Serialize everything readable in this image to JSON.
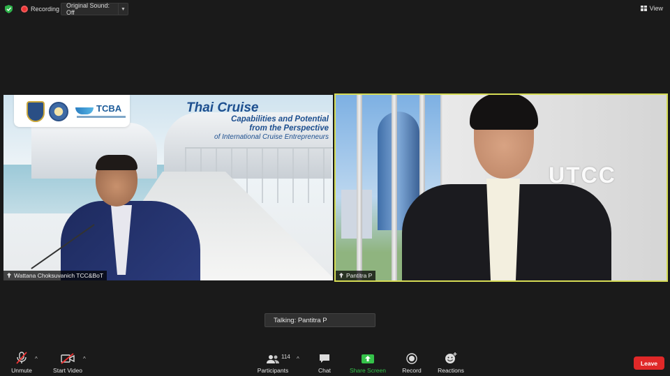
{
  "topbar": {
    "recording_label": "Recording",
    "original_sound_label": "Original Sound: Off",
    "view_label": "View"
  },
  "tiles": {
    "left": {
      "name": "Wattana Choksuvanich TCC&BoT",
      "slide": {
        "logo_text": "TCBA",
        "title": "Thai Cruise",
        "subtitle_1": "Capabilities and Potential",
        "subtitle_2": "from the Perspective",
        "subtitle_3": "of International Cruise Entrepreneurs"
      }
    },
    "right": {
      "name": "Pantitra P",
      "wall_text": "UTCC",
      "active_speaker_color": "#d6dc55"
    }
  },
  "talking": "Talking: Pantitra P",
  "toolbar": {
    "unmute": "Unmute",
    "start_video": "Start Video",
    "participants": "Participants",
    "participants_count": "114",
    "chat": "Chat",
    "share_screen": "Share Screen",
    "record": "Record",
    "reactions": "Reactions",
    "leave": "Leave"
  },
  "colors": {
    "share_green": "#35c24a",
    "leave_red": "#e02828",
    "recording_red": "#ee3333"
  }
}
